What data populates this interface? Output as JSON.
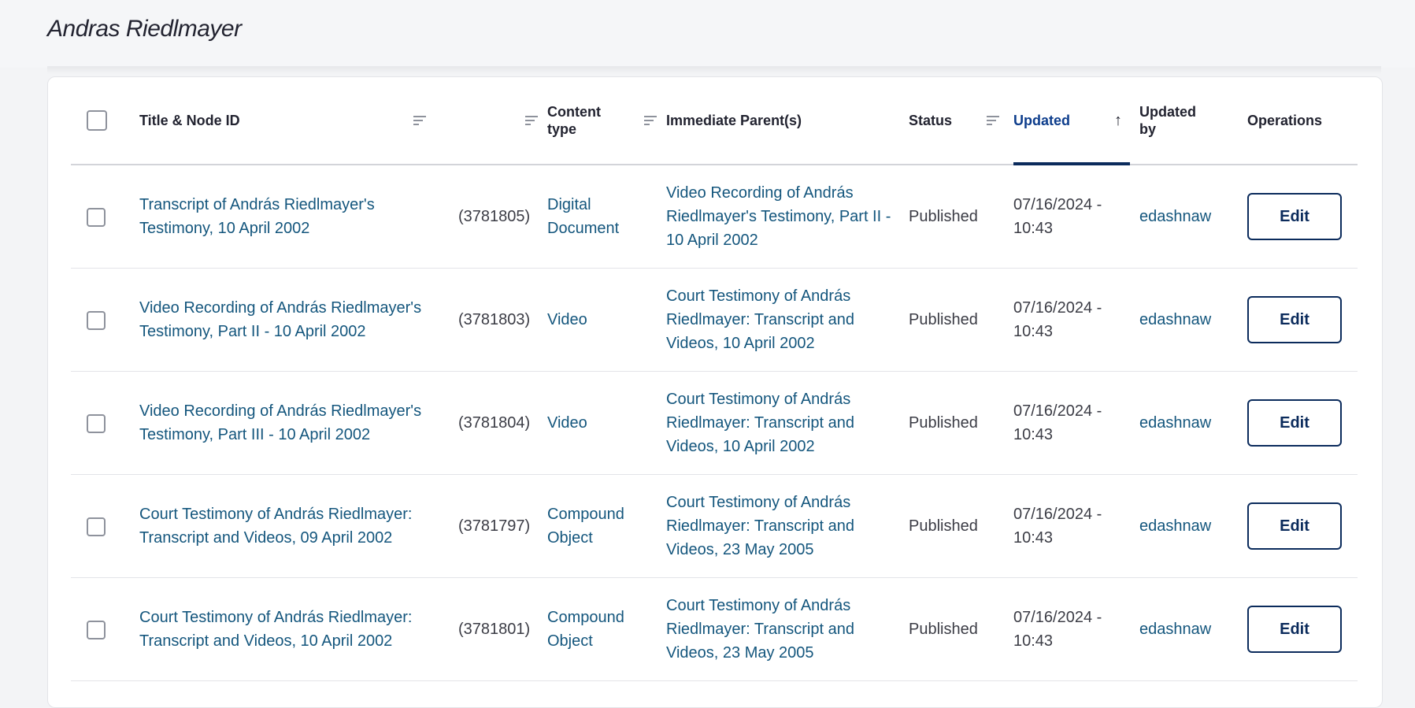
{
  "page": {
    "title": "Andras Riedlmayer"
  },
  "table": {
    "columns": {
      "title": "Title & Node ID",
      "content_type": "Content type",
      "parent": "Immediate Parent(s)",
      "status": "Status",
      "updated": "Updated",
      "updated_by": "Updated by",
      "operations": "Operations"
    },
    "rows": [
      {
        "title": "Transcript of András Riedlmayer's Testimony, 10 April 2002",
        "node_id": "(3781805)",
        "content_type": "Digital Document",
        "parent": "Video Recording of András Riedlmayer's Testimony, Part II - 10 April 2002",
        "status": "Published",
        "updated": "07/16/2024 - 10:43",
        "updated_by": "edashnaw",
        "operation": "Edit"
      },
      {
        "title": "Video Recording of András Riedlmayer's Testimony, Part II - 10 April 2002",
        "node_id": "(3781803)",
        "content_type": "Video",
        "parent": "Court Testimony of András Riedlmayer: Transcript and Videos, 10 April 2002",
        "status": "Published",
        "updated": "07/16/2024 - 10:43",
        "updated_by": "edashnaw",
        "operation": "Edit"
      },
      {
        "title": "Video Recording of András Riedlmayer's Testimony, Part III - 10 April 2002",
        "node_id": "(3781804)",
        "content_type": "Video",
        "parent": "Court Testimony of András Riedlmayer: Transcript and Videos, 10 April 2002",
        "status": "Published",
        "updated": "07/16/2024 - 10:43",
        "updated_by": "edashnaw",
        "operation": "Edit"
      },
      {
        "title": "Court Testimony of András Riedlmayer: Transcript and Videos, 09 April 2002",
        "node_id": "(3781797)",
        "content_type": "Compound Object",
        "parent": "Court Testimony of András Riedlmayer: Transcript and Videos, 23 May 2005",
        "status": "Published",
        "updated": "07/16/2024 - 10:43",
        "updated_by": "edashnaw",
        "operation": "Edit"
      },
      {
        "title": "Court Testimony of András Riedlmayer: Transcript and Videos, 10 April 2002",
        "node_id": "(3781801)",
        "content_type": "Compound Object",
        "parent": "Court Testimony of András Riedlmayer: Transcript and Videos, 23 May 2005",
        "status": "Published",
        "updated": "07/16/2024 - 10:43",
        "updated_by": "edashnaw",
        "operation": "Edit"
      }
    ]
  },
  "colors": {
    "link": "#14567d",
    "accent": "#0b2b5c"
  }
}
